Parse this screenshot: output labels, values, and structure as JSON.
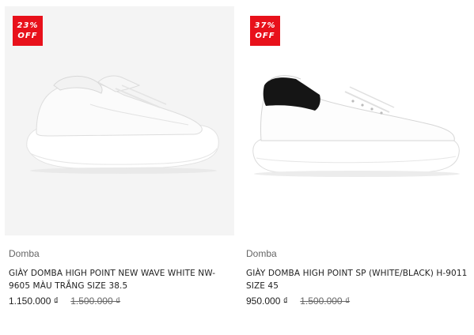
{
  "products": [
    {
      "badge_percent": "23%",
      "badge_off": "OFF",
      "image_icon": "white-chunky-sneaker-image",
      "brand": "Domba",
      "title": "GIÀY DOMBA HIGH POINT NEW WAVE WHITE NW-9605 MÀU TRẮNG SIZE 38.5",
      "price": "1.150.000 ₫",
      "old_price": "1.500.000 ₫"
    },
    {
      "badge_percent": "37%",
      "badge_off": "OFF",
      "image_icon": "white-black-sneaker-image",
      "brand": "Domba",
      "title": "GIÀY DOMBA HIGH POINT SP (WHITE/BLACK) H-9011 SIZE 45",
      "price": "950.000 ₫",
      "old_price": "1.500.000 ₫"
    }
  ],
  "colors": {
    "badge": "#e8111b",
    "card1_image_bg": "#f4f4f4"
  }
}
